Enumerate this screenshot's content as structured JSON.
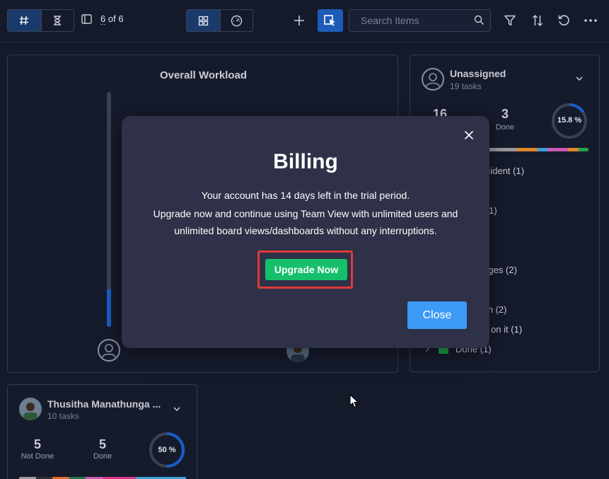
{
  "toolbar": {
    "view_toggle": {
      "hash_icon": "hash-icon",
      "hourglass_icon": "hourglass-icon"
    },
    "pager": {
      "current": "6",
      "of_label": "of",
      "total": "6"
    },
    "layout_toggle": {
      "grid_icon": "grid-icon",
      "dashboard_icon": "gauge-icon"
    },
    "search": {
      "placeholder": "Search Items",
      "value": ""
    },
    "icons": [
      "plus-icon",
      "select-cursor-icon",
      "filter-icon",
      "sort-icon",
      "refresh-icon",
      "more-icon"
    ]
  },
  "workload": {
    "title": "Overall Workload",
    "fill_fraction": 0.16
  },
  "unassigned": {
    "name": "Unassigned",
    "tasks": "19 tasks",
    "not_done_count": "16",
    "done_count": "3",
    "done_label": "Done",
    "percent_label": "15.8 %",
    "percent_value": 15.8,
    "bar_colors": [
      "#9b9b9b",
      "#e0862a",
      "#3aa0d8",
      "#c85bb0",
      "#e0862a",
      "#1fa34a"
    ],
    "items": [
      {
        "label": "Incident (1)"
      },
      {
        "label": "n (1)"
      },
      {
        "label": "anges (2)"
      },
      {
        "label": "tion (2)"
      },
      {
        "label": "ng on it (1)"
      },
      {
        "label": "Done (1)"
      }
    ]
  },
  "thusitha": {
    "name": "Thusitha Manathunga ...",
    "tasks": "10 tasks",
    "not_done_count": "5",
    "not_done_label": "Not Done",
    "done_count": "5",
    "done_label": "Done",
    "percent_label": "50 %",
    "percent_value": 50,
    "bar_colors": [
      "#9b9b9b",
      "#2b2f3d",
      "#e06a2a",
      "#1f7a4a",
      "#c85bb0",
      "#d6388a",
      "#3aa0d8"
    ]
  },
  "billing": {
    "title": "Billing",
    "line1": "Your account has 14 days left in the trial period.",
    "line2": "Upgrade now and continue using Team View with unlimited users and",
    "line3": "unlimited board views/dashboards without any interruptions.",
    "upgrade_label": "Upgrade Now",
    "close_label": "Close"
  },
  "colors": {
    "accent": "#1e5bb8",
    "upgrade_green": "#16c06b",
    "close_blue": "#3d9bf5",
    "highlight_red": "#e03a3a"
  }
}
